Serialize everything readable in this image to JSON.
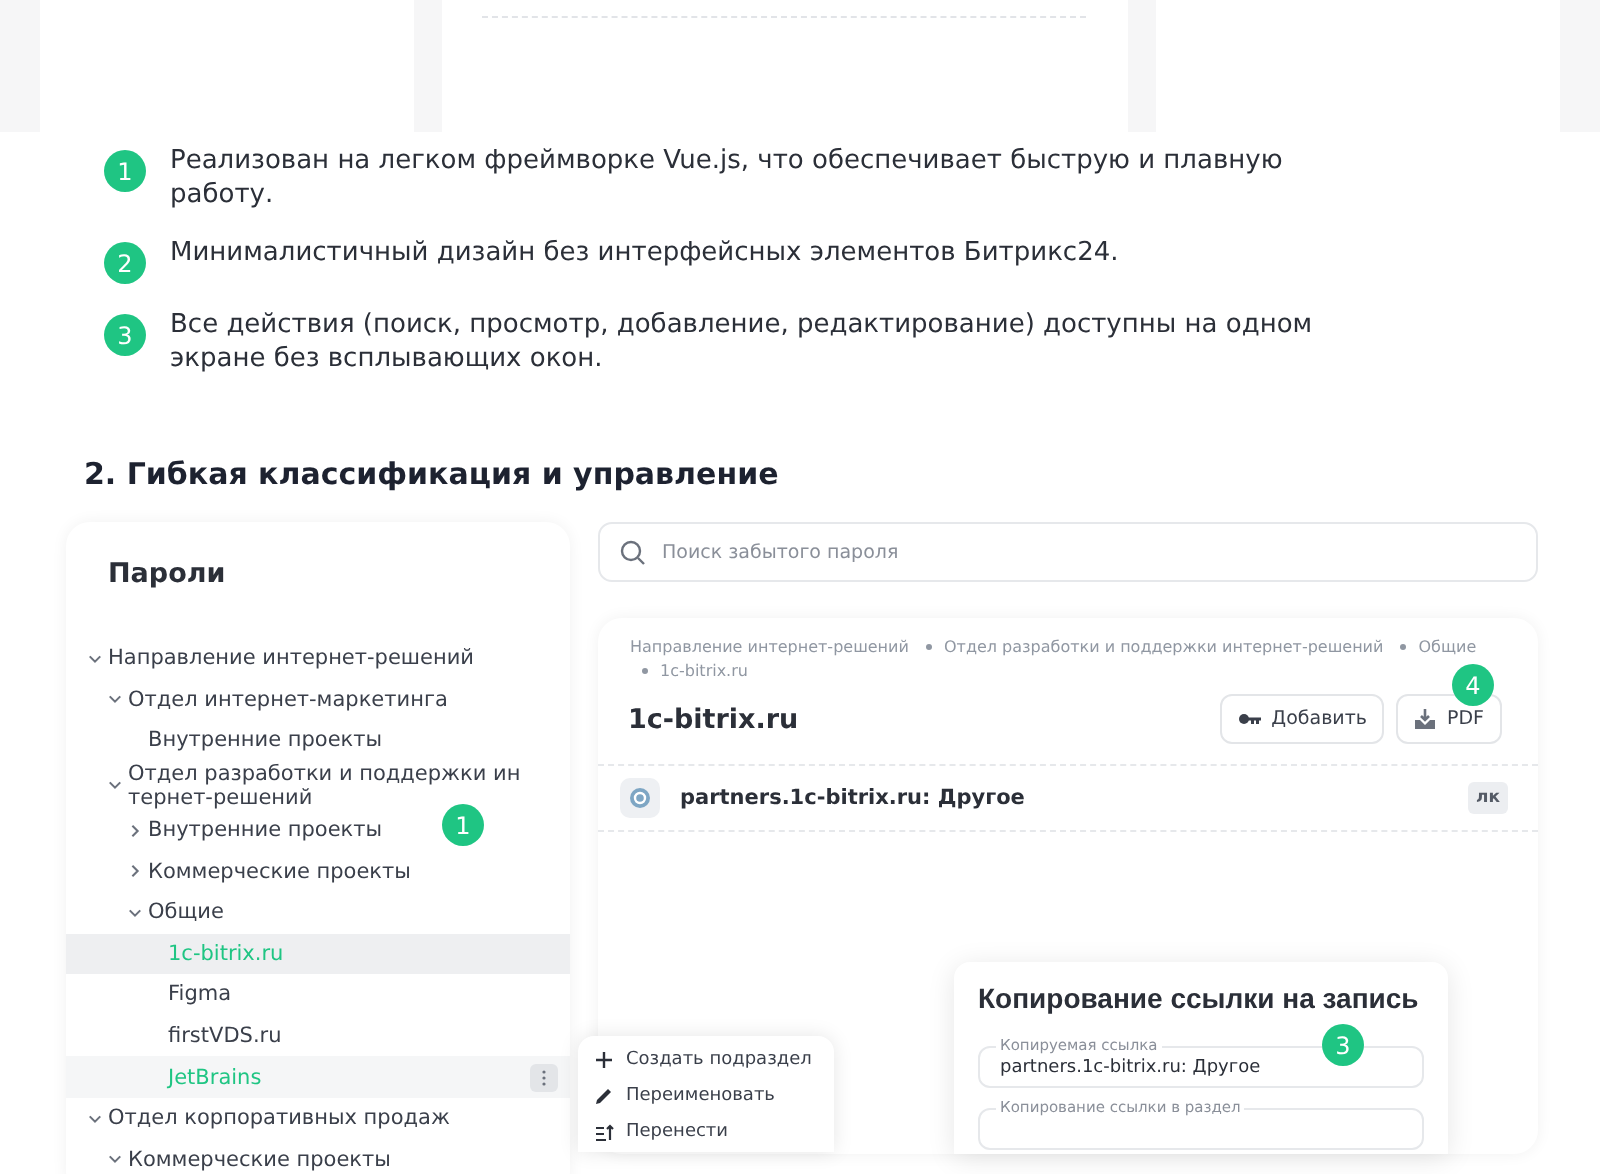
{
  "features": [
    {
      "number": "1",
      "text": "Реализован на легком фреймворке Vue.js, что обеспечивает быструю и плавную работу."
    },
    {
      "number": "2",
      "text": "Минималистичный дизайн без интерфейсных элементов Битрикс24."
    },
    {
      "number": "3",
      "text": "Все действия (поиск, просмотр, добавление, редактирование) доступны на одном экране без всплывающих окон."
    }
  ],
  "section_heading": "2. Гибкая классификация и управление",
  "sidebar": {
    "title": "Пароли",
    "marker": "1",
    "tree": [
      {
        "label": "Направление интернет-решений",
        "expanded": true,
        "children": [
          {
            "label": "Отдел интернет-маркетинга",
            "expanded": true,
            "children": [
              {
                "label": "Внутренние проекты"
              }
            ]
          },
          {
            "label": "Отдел разработки и поддержки интернет-решений",
            "expanded": true,
            "children": [
              {
                "label": "Внутренние проекты",
                "expanded": false
              },
              {
                "label": "Коммерческие проекты",
                "expanded": false
              },
              {
                "label": "Общие",
                "expanded": true,
                "children": [
                  {
                    "label": "1c-bitrix.ru",
                    "selected": true,
                    "menu_open": false
                  },
                  {
                    "label": "Figma",
                    "selected": false,
                    "menu_open": false
                  },
                  {
                    "label": "firstVDS.ru",
                    "selected": false,
                    "menu_open": false
                  },
                  {
                    "label": "JetBrains",
                    "selected": false,
                    "menu_open": true
                  }
                ]
              }
            ]
          }
        ]
      },
      {
        "label": "Отдел корпоративных продаж",
        "expanded": true,
        "children": [
          {
            "label": "Коммерческие проекты",
            "expanded": true
          }
        ]
      }
    ]
  },
  "context_menu": [
    {
      "kind": "add",
      "label": "Создать подраздел"
    },
    {
      "kind": "rename",
      "label": "Переименовать"
    },
    {
      "kind": "move",
      "label": "Перенести"
    }
  ],
  "search": {
    "placeholder": "Поиск забытого пароля"
  },
  "record": {
    "breadcrumbs": [
      "Направление интернет-решений",
      "Отдел разработки и поддержки интернет-решений",
      "Общие",
      "1c-bitrix.ru"
    ],
    "title": "1c-bitrix.ru",
    "buttons": [
      {
        "kind": "add",
        "label": "Добавить"
      },
      {
        "kind": "export",
        "label": "PDF",
        "marker": "4"
      }
    ],
    "entry": {
      "name": "partners.1c-bitrix.ru: Другое",
      "tag": "лк"
    }
  },
  "dialog": {
    "title": "Копирование ссылки на запись",
    "fields": [
      {
        "label": "Копируемая ссылка",
        "value": "partners.1c-bitrix.ru: Другое",
        "marker": "3"
      },
      {
        "label": "Копирование ссылки в раздел"
      }
    ]
  }
}
